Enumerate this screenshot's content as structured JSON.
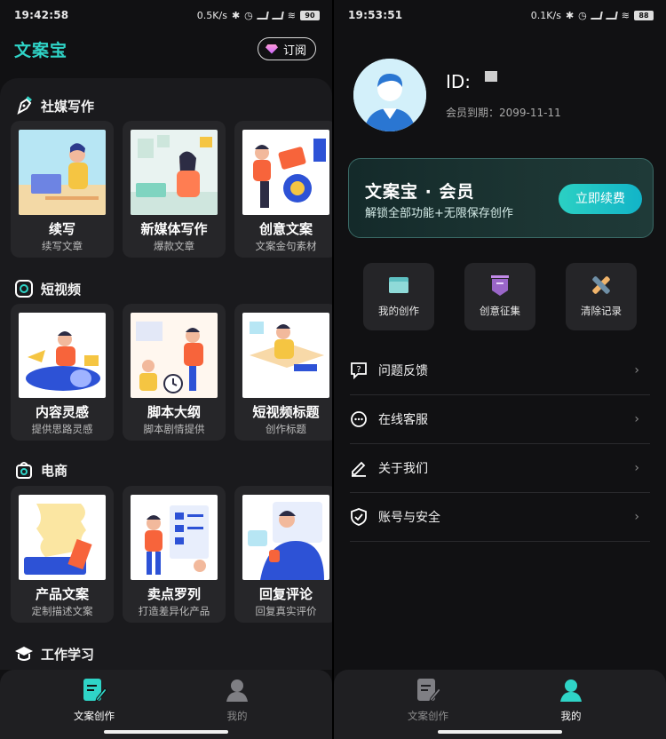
{
  "left": {
    "status": {
      "time": "19:42:58",
      "speed": "0.5K/s",
      "battery": "90"
    },
    "app_title": "文案宝",
    "subscribe_label": "订阅",
    "sections": [
      {
        "title": "社媒写作",
        "icon": "pen-nib-icon",
        "cards": [
          {
            "title": "续写",
            "desc": "续写文章",
            "art": "writer-laptop-illustration"
          },
          {
            "title": "新媒体写作",
            "desc": "爆款文章",
            "art": "woman-at-desk-illustration"
          },
          {
            "title": "创意文案",
            "desc": "文案金句素材",
            "art": "creative-people-illustration"
          }
        ]
      },
      {
        "title": "短视频",
        "icon": "camera-icon",
        "cards": [
          {
            "title": "内容灵感",
            "desc": "提供思路灵感",
            "art": "rocket-rider-illustration"
          },
          {
            "title": "脚本大纲",
            "desc": "脚本剧情提供",
            "art": "script-clock-illustration"
          },
          {
            "title": "短视频标题",
            "desc": "创作标题",
            "art": "book-reader-illustration"
          }
        ]
      },
      {
        "title": "电商",
        "icon": "shop-bag-icon",
        "cards": [
          {
            "title": "产品文案",
            "desc": "定制描述文案",
            "art": "scroll-document-illustration"
          },
          {
            "title": "卖点罗列",
            "desc": "打造差异化产品",
            "art": "presentation-list-illustration"
          },
          {
            "title": "回复评论",
            "desc": "回复真实评价",
            "art": "chat-reply-illustration"
          }
        ]
      },
      {
        "title": "工作学习",
        "icon": "graduation-cap-icon",
        "cards": []
      }
    ],
    "tabs": [
      {
        "label": "文案创作",
        "active": true
      },
      {
        "label": "我的",
        "active": false
      }
    ]
  },
  "right": {
    "status": {
      "time": "19:53:51",
      "speed": "0.1K/s",
      "battery": "88"
    },
    "user_id": "ID:",
    "expire_text": "会员到期：2099-11-11",
    "vip": {
      "title": "文案宝 · 会员",
      "subtitle": "解锁全部功能+无限保存创作",
      "renew_label": "立即续费"
    },
    "quick": [
      {
        "label": "我的创作",
        "icon": "folder-icon"
      },
      {
        "label": "创意征集",
        "icon": "bookmark-shield-icon"
      },
      {
        "label": "清除记录",
        "icon": "eraser-cross-icon"
      }
    ],
    "menu": [
      {
        "label": "问题反馈",
        "icon": "feedback-question-icon"
      },
      {
        "label": "在线客服",
        "icon": "chat-support-icon"
      },
      {
        "label": "关于我们",
        "icon": "edit-pen-icon"
      },
      {
        "label": "账号与安全",
        "icon": "shield-check-icon"
      }
    ],
    "tabs": [
      {
        "label": "文案创作",
        "active": false
      },
      {
        "label": "我的",
        "active": true
      }
    ]
  },
  "colors": {
    "accent": "#2fd4c7",
    "bg": "#111113",
    "card": "#262629",
    "tab_inactive": "#8d8d8d"
  }
}
